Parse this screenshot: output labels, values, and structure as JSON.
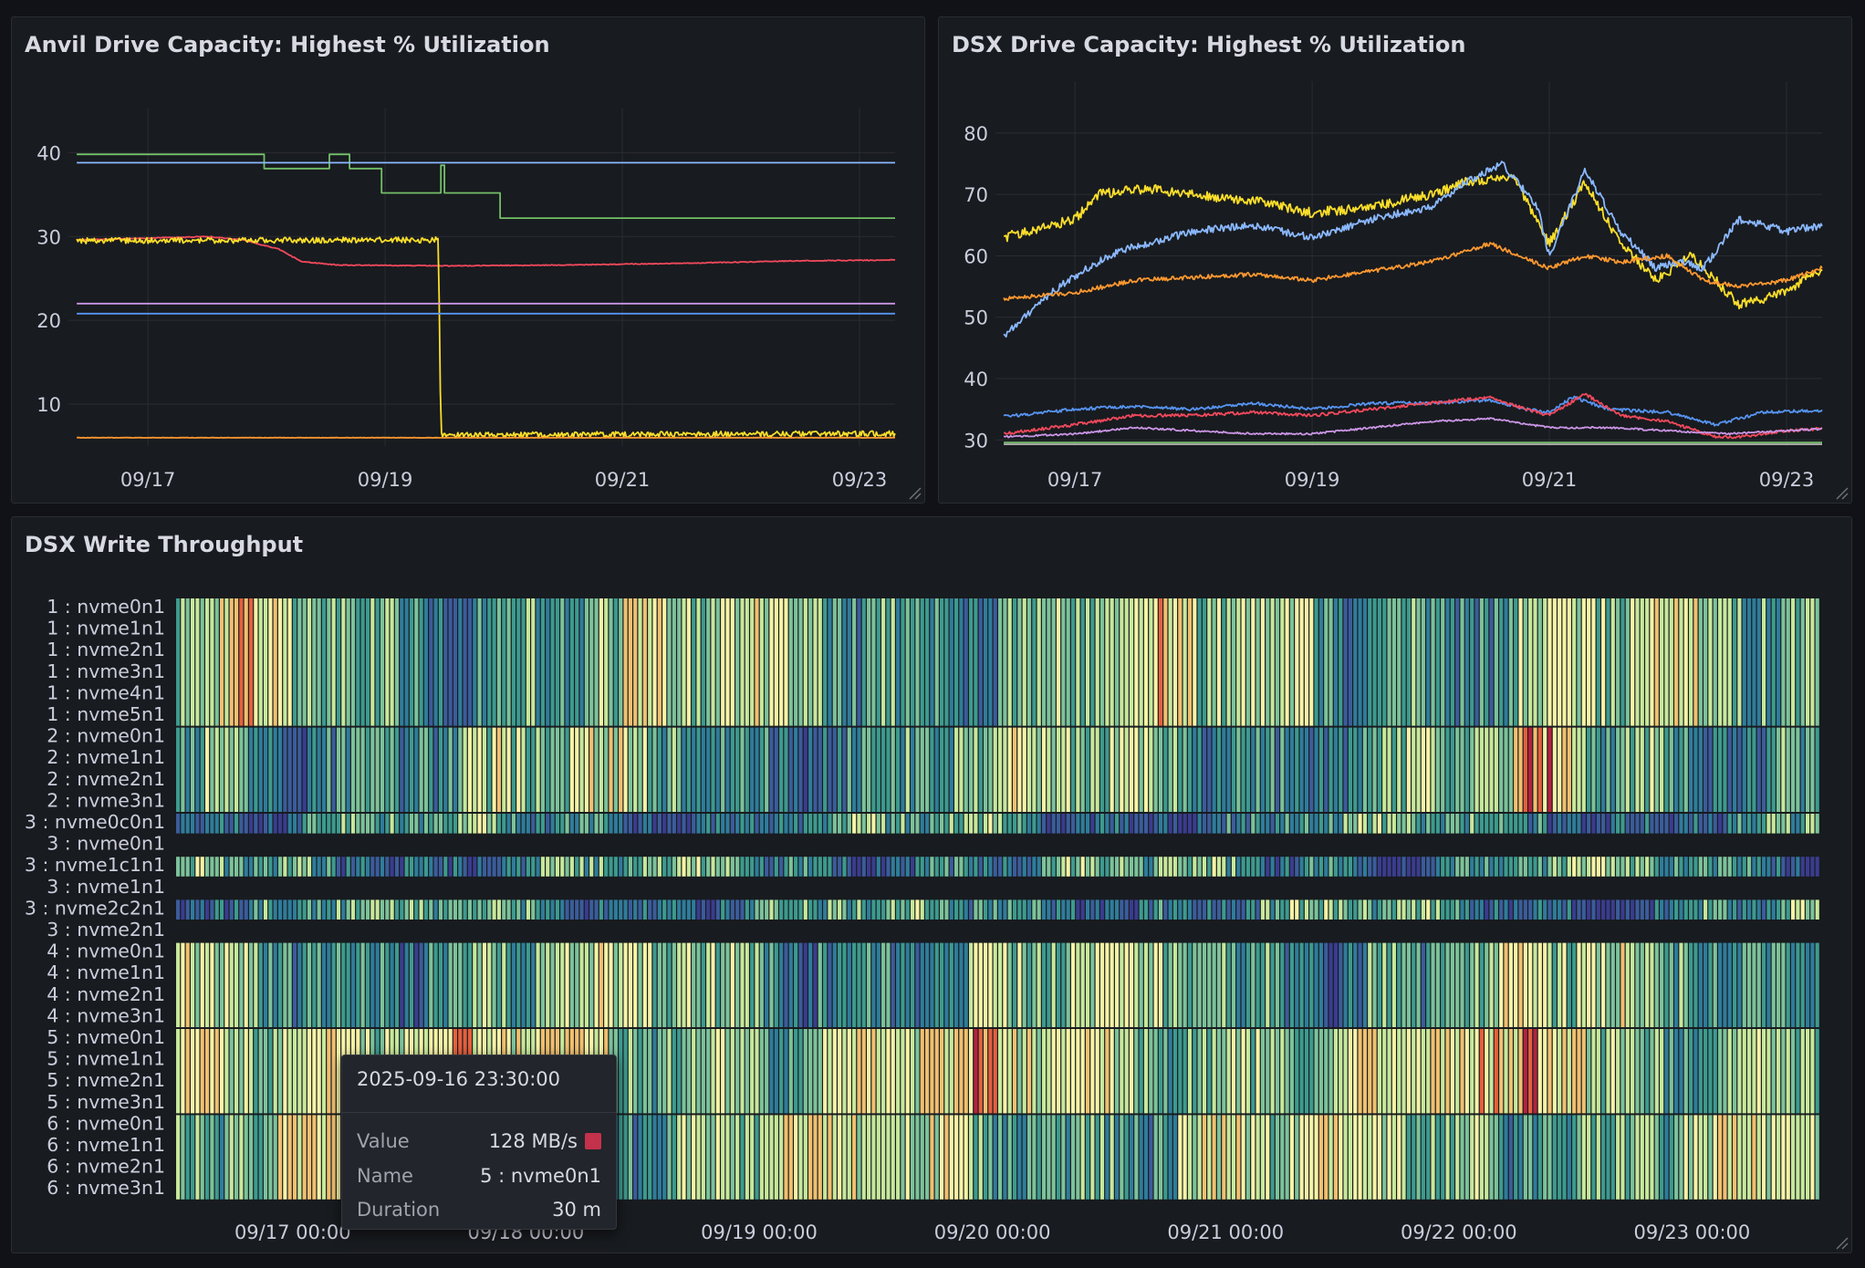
{
  "panels": {
    "anvil": {
      "title": "Anvil Drive Capacity: Highest % Utilization"
    },
    "dsx": {
      "title": "DSX Drive Capacity: Highest % Utilization"
    },
    "heatmap": {
      "title": "DSX Write Throughput"
    }
  },
  "chart_data": [
    {
      "type": "line",
      "title": "Anvil Drive Capacity: Highest % Utilization",
      "ylim": [
        5,
        42
      ],
      "yticks": [
        10,
        20,
        30,
        40
      ],
      "xlim": [
        16.33,
        23.3
      ],
      "xticks": [
        {
          "v": 17,
          "label": "09/17"
        },
        {
          "v": 19,
          "label": "09/19"
        },
        {
          "v": 21,
          "label": "09/21"
        },
        {
          "v": 23,
          "label": "09/23"
        }
      ],
      "grid": true,
      "series": [
        {
          "color": "#73bf69",
          "step": true,
          "noise": 0,
          "x": [
            16.4,
            17.98,
            17.98,
            18.53,
            18.53,
            18.7,
            18.7,
            18.97,
            18.97,
            19.47,
            19.47,
            19.5,
            19.5,
            19.97,
            19.97,
            23.3
          ],
          "y": [
            39.8,
            39.8,
            38.1,
            38.1,
            39.8,
            39.8,
            38.1,
            38.1,
            35.2,
            35.2,
            38.5,
            38.5,
            35.2,
            35.2,
            32.2,
            32.2
          ]
        },
        {
          "color": "#8ab8ff",
          "noise": 0,
          "x": [
            16.4,
            23.3
          ],
          "y": [
            38.8,
            38.8
          ]
        },
        {
          "color": "#f2495c",
          "noise": 0.05,
          "x": [
            16.4,
            17.0,
            17.5,
            17.8,
            18.1,
            18.3,
            18.6,
            19.5,
            20.5,
            21.5,
            22.5,
            23.3
          ],
          "y": [
            29.6,
            29.8,
            30.0,
            29.6,
            28.5,
            27.0,
            26.6,
            26.5,
            26.6,
            26.8,
            27.1,
            27.2
          ]
        },
        {
          "color": "#fade2a",
          "noise": 0.35,
          "x": [
            16.4,
            19.45,
            19.47,
            23.3
          ],
          "y": [
            29.5,
            29.6,
            6.3,
            6.5
          ]
        },
        {
          "color": "#ca95e5",
          "noise": 0,
          "x": [
            16.4,
            23.3
          ],
          "y": [
            22.0,
            22.0
          ]
        },
        {
          "color": "#5794f2",
          "noise": 0,
          "x": [
            16.4,
            23.3
          ],
          "y": [
            20.8,
            20.8
          ]
        },
        {
          "color": "#ff9830",
          "noise": 0.02,
          "x": [
            16.4,
            23.3
          ],
          "y": [
            6.0,
            6.0
          ]
        }
      ]
    },
    {
      "type": "line",
      "title": "DSX Drive Capacity: Highest % Utilization",
      "ylim": [
        29,
        84
      ],
      "yticks": [
        30,
        40,
        50,
        60,
        70,
        80
      ],
      "xlim": [
        16.33,
        23.3
      ],
      "xticks": [
        {
          "v": 17,
          "label": "09/17"
        },
        {
          "v": 19,
          "label": "09/19"
        },
        {
          "v": 21,
          "label": "09/21"
        },
        {
          "v": 23,
          "label": "09/23"
        }
      ],
      "grid": true,
      "series": [
        {
          "color": "#fade2a",
          "noise": 0.8,
          "x": [
            16.4,
            17.0,
            17.2,
            17.6,
            18.0,
            18.5,
            19.0,
            19.5,
            20.0,
            20.3,
            20.7,
            21.0,
            21.3,
            21.6,
            21.9,
            22.2,
            22.6,
            23.0,
            23.3
          ],
          "y": [
            63,
            66,
            70,
            71,
            70,
            69,
            67,
            68,
            70,
            72,
            73,
            62,
            72,
            62,
            56,
            60,
            52,
            54,
            58
          ]
        },
        {
          "color": "#8ab8ff",
          "noise": 0.6,
          "x": [
            16.4,
            16.8,
            17.1,
            17.4,
            18.0,
            18.5,
            19.0,
            19.5,
            20.0,
            20.3,
            20.6,
            20.9,
            21.0,
            21.3,
            21.6,
            21.9,
            22.1,
            22.3,
            22.6,
            23.0,
            23.3
          ],
          "y": [
            47,
            54,
            58,
            61,
            64,
            65,
            63,
            66,
            68,
            72,
            75,
            68,
            60,
            74,
            64,
            58,
            59,
            58,
            66,
            64,
            65
          ]
        },
        {
          "color": "#ff9830",
          "noise": 0.35,
          "x": [
            16.4,
            17.0,
            17.5,
            18.0,
            18.5,
            19.0,
            19.5,
            20.0,
            20.5,
            21.0,
            21.3,
            21.6,
            22.0,
            22.3,
            22.6,
            23.0,
            23.3
          ],
          "y": [
            53,
            54,
            56,
            56.5,
            57,
            56,
            57.5,
            59,
            62,
            58,
            60,
            59,
            60,
            56,
            55,
            56,
            58
          ]
        },
        {
          "color": "#5794f2",
          "noise": 0.25,
          "x": [
            16.4,
            17.0,
            17.5,
            18.0,
            18.5,
            19.0,
            19.5,
            20.0,
            20.5,
            20.8,
            21.0,
            21.2,
            21.5,
            22.0,
            22.4,
            22.8,
            23.3
          ],
          "y": [
            33.8,
            35,
            35.5,
            35,
            36,
            35,
            36,
            36,
            36.5,
            35,
            34.5,
            37,
            35,
            34.5,
            32.5,
            34.5,
            34.8
          ]
        },
        {
          "color": "#f2495c",
          "noise": 0.25,
          "x": [
            16.4,
            17.0,
            17.5,
            18.0,
            18.5,
            19.0,
            19.5,
            20.0,
            20.5,
            20.8,
            21.0,
            21.3,
            21.6,
            22.0,
            22.4,
            22.6,
            23.0,
            23.3
          ],
          "y": [
            31,
            32.5,
            34,
            34,
            34.5,
            34,
            35,
            36,
            37,
            35,
            34,
            37.5,
            34,
            33,
            30.5,
            30.5,
            31.5,
            31.8
          ]
        },
        {
          "color": "#ca95e5",
          "noise": 0.15,
          "x": [
            16.4,
            17.0,
            17.5,
            18.0,
            18.5,
            19.0,
            19.5,
            20.0,
            20.5,
            21.0,
            21.5,
            22.0,
            22.5,
            23.0,
            23.3
          ],
          "y": [
            30.5,
            31,
            32,
            31.5,
            31,
            31,
            32,
            33,
            33.5,
            32,
            32,
            31.5,
            31,
            31.5,
            31.8
          ]
        },
        {
          "color": "#73bf69",
          "noise": 0,
          "x": [
            16.4,
            23.3
          ],
          "y": [
            29.6,
            29.6
          ]
        },
        {
          "color": "#b8b8b8",
          "noise": 0,
          "x": [
            16.4,
            23.3
          ],
          "y": [
            29.3,
            29.3
          ]
        }
      ]
    },
    {
      "type": "heatmap",
      "title": "DSX Write Throughput",
      "rows": [
        "1 : nvme0n1",
        "1 : nvme1n1",
        "1 : nvme2n1",
        "1 : nvme3n1",
        "1 : nvme4n1",
        "1 : nvme5n1",
        "2 : nvme0n1",
        "2 : nvme1n1",
        "2 : nvme2n1",
        "2 : nvme3n1",
        "3 : nvme0c0n1",
        "3 : nvme0n1",
        "3 : nvme1c1n1",
        "3 : nvme1n1",
        "3 : nvme2c2n1",
        "3 : nvme2n1",
        "4 : nvme0n1",
        "4 : nvme1n1",
        "4 : nvme2n1",
        "4 : nvme3n1",
        "5 : nvme0n1",
        "5 : nvme1n1",
        "5 : nvme2n1",
        "5 : nvme3n1",
        "6 : nvme0n1",
        "6 : nvme1n1",
        "6 : nvme2n1",
        "6 : nvme3n1"
      ],
      "groups": [
        [
          0,
          5
        ],
        [
          6,
          9
        ],
        [
          10,
          10
        ],
        [
          11,
          11
        ],
        [
          12,
          12
        ],
        [
          13,
          13
        ],
        [
          14,
          14
        ],
        [
          15,
          15
        ],
        [
          16,
          19
        ],
        [
          20,
          23
        ],
        [
          24,
          27
        ]
      ],
      "empty_rows": [
        11,
        13,
        15
      ],
      "xlim": [
        16.5,
        23.55
      ],
      "xticks": [
        {
          "v": 17.0,
          "label": "09/17 00:00"
        },
        {
          "v": 18.0,
          "label": "09/18 00:00"
        },
        {
          "v": 19.0,
          "label": "09/19 00:00"
        },
        {
          "v": 20.0,
          "label": "09/20 00:00"
        },
        {
          "v": 21.0,
          "label": "09/21 00:00"
        },
        {
          "v": 22.0,
          "label": "09/22 00:00"
        },
        {
          "v": 23.0,
          "label": "09/23 00:00"
        }
      ],
      "palette": [
        "#3a3c8e",
        "#3b5c9b",
        "#2f7c9a",
        "#3d9a8e",
        "#7cc29a",
        "#c7e89b",
        "#f6f3a6",
        "#f0c070",
        "#e4603e",
        "#b3223f"
      ]
    }
  ],
  "tooltip": {
    "time": "2025-09-16 23:30:00",
    "rows": [
      {
        "key": "Value",
        "value": "128 MB/s"
      },
      {
        "key": "Name",
        "value": "5 : nvme0n1"
      },
      {
        "key": "Duration",
        "value": "30 m"
      }
    ],
    "swatch_color": "#c4314b"
  }
}
